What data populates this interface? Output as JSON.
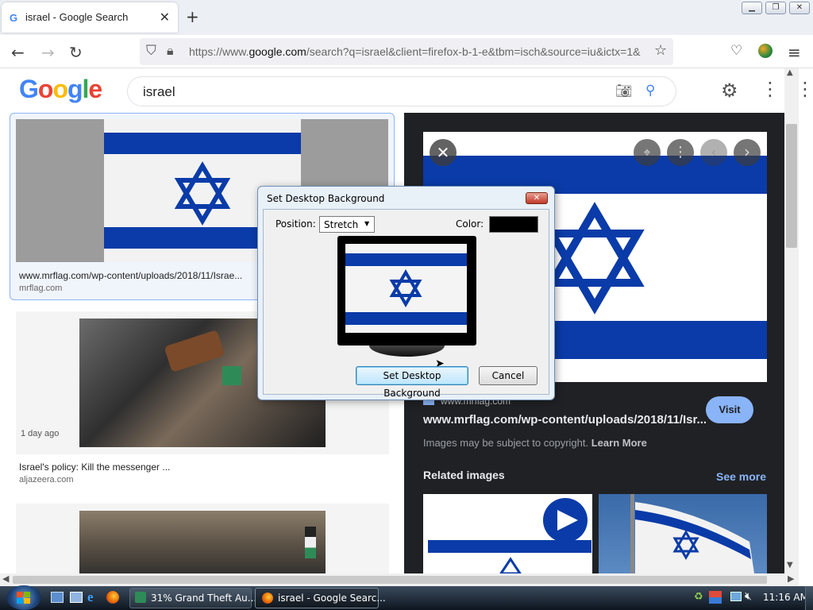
{
  "browser": {
    "tab_title": "israel - Google Search",
    "tab_favicon": "G",
    "url_prefix": "https://www.",
    "url_host": "google.com",
    "url_rest": "/search?q=israel&client=firefox-b-1-e&tbm=isch&source=iu&ictx=1&"
  },
  "google": {
    "logo_letters": [
      "G",
      "o",
      "o",
      "g",
      "l",
      "e"
    ],
    "logo_colors": [
      "#4285f4",
      "#ea4335",
      "#fbbc05",
      "#4285f4",
      "#34a853",
      "#ea4335"
    ],
    "query": "israel"
  },
  "results": [
    {
      "url": "www.mrflag.com/wp-content/uploads/2018/11/Israe...",
      "domain": "mrflag.com"
    },
    {
      "age": "1 day ago",
      "title": "Israel's policy: Kill the messenger ...",
      "domain": "aljazeera.com"
    }
  ],
  "preview": {
    "source_domain": "www.mrflag.com",
    "url": "www.mrflag.com/wp-content/uploads/2018/11/Isr...",
    "visit_label": "Visit",
    "copyright": "Images may be subject to copyright.",
    "learn_more": "Learn More",
    "related_title": "Related images",
    "see_more": "See more"
  },
  "dialog": {
    "title": "Set Desktop Background",
    "position_label": "Position:",
    "position_value": "Stretch",
    "color_label": "Color:",
    "set_label": "Set Desktop Background",
    "cancel_label": "Cancel",
    "color_value": "#000000"
  },
  "taskbar": {
    "task1": "31% Grand Theft Au...",
    "task2": "israel - Google Searc...",
    "clock": "11:16 AM"
  },
  "colors": {
    "flag_blue": "#0a3ba8",
    "visit_bg": "#8ab4f8",
    "link_blue": "#8ab4f8"
  }
}
